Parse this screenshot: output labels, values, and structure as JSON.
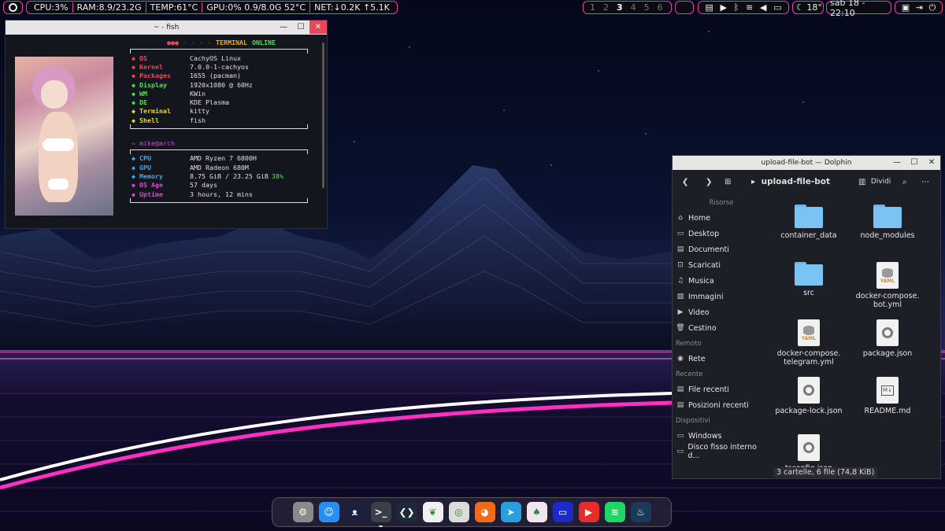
{
  "topbar": {
    "stats": [
      "CPU:3%",
      "RAM:8.9/23.2G",
      "TEMP:61°C",
      "GPU:0%  0.9/8.0G  52°C",
      "NET:↓0.2K ↑5.1K"
    ],
    "workspaces": [
      "1",
      "2",
      "3",
      "4",
      "5",
      "6"
    ],
    "active_workspace": "3",
    "tray_icons": [
      "clipboard-icon",
      "media-icon",
      "bluetooth-icon",
      "wifi-icon",
      "volume-icon",
      "battery-icon"
    ],
    "weather": "18°",
    "datetime": "sab 18 - 22:10"
  },
  "terminal": {
    "title": "~ - fish",
    "header_a": "TERMINAL",
    "header_b": "ONLINE",
    "sys": [
      {
        "key": "OS",
        "value": "CachyOS Linux",
        "color": "#e8485a"
      },
      {
        "key": "Kernel",
        "value": "7.0.0-1-cachyos",
        "color": "#e8485a"
      },
      {
        "key": "Packages",
        "value": "1655 (pacman)",
        "color": "#e8485a"
      },
      {
        "key": "Display",
        "value": "1920x1080 @ 60Hz",
        "color": "#4fe04f"
      },
      {
        "key": "WM",
        "value": "KWin",
        "color": "#4fe04f"
      },
      {
        "key": "DE",
        "value": "KDE Plasma",
        "color": "#4fe04f"
      },
      {
        "key": "Terminal",
        "value": "kitty",
        "color": "#f5d623"
      },
      {
        "key": "Shell",
        "value": "fish",
        "color": "#f5d623"
      }
    ],
    "user": "mike@arch",
    "hw": [
      {
        "key": "CPU",
        "value": "AMD Ryzen 7 6800H",
        "color": "#4aa3f0"
      },
      {
        "key": "GPU",
        "value": "AMD Radeon 680M",
        "color": "#4aa3f0"
      },
      {
        "key": "Memory",
        "value": "8.75 GiB / 23.25 GiB",
        "extra": "38%",
        "color": "#4aa3f0"
      },
      {
        "key": "OS Age",
        "value": "57 days",
        "color": "#d24ad8"
      },
      {
        "key": "Uptime",
        "value": "3 hours, 12 mins",
        "color": "#d24ad8"
      }
    ]
  },
  "dolphin": {
    "title": "upload-file-bot — Dolphin",
    "path": "upload-file-bot",
    "split_label": "Dividi",
    "sidebar": [
      {
        "type": "cat",
        "label": "Risorse"
      },
      {
        "type": "item",
        "label": "Home",
        "icon": "⌂"
      },
      {
        "type": "item",
        "label": "Desktop",
        "icon": "▭"
      },
      {
        "type": "item",
        "label": "Documenti",
        "icon": "▤"
      },
      {
        "type": "item",
        "label": "Scaricati",
        "icon": "⊡"
      },
      {
        "type": "item",
        "label": "Musica",
        "icon": "♫"
      },
      {
        "type": "item",
        "label": "Immagini",
        "icon": "▨"
      },
      {
        "type": "item",
        "label": "Video",
        "icon": "▶"
      },
      {
        "type": "item",
        "label": "Cestino",
        "icon": "🗑"
      },
      {
        "type": "cat",
        "label": "Remoto"
      },
      {
        "type": "item",
        "label": "Rete",
        "icon": "◉"
      },
      {
        "type": "cat",
        "label": "Recente"
      },
      {
        "type": "item",
        "label": "File recenti",
        "icon": "▤"
      },
      {
        "type": "item",
        "label": "Posizioni recenti",
        "icon": "▤"
      },
      {
        "type": "cat",
        "label": "Dispositivi"
      },
      {
        "type": "item",
        "label": "Windows",
        "icon": "▭"
      },
      {
        "type": "item",
        "label": "Disco fisso interno d...",
        "icon": "▭"
      }
    ],
    "files": [
      {
        "name": "container_data",
        "kind": "folder"
      },
      {
        "name": "node_modules",
        "kind": "folder"
      },
      {
        "name": "src",
        "kind": "folder"
      },
      {
        "name": "docker-compose.\nbot.yml",
        "kind": "yaml"
      },
      {
        "name": "docker-compose.\ntelegram.yml",
        "kind": "yaml"
      },
      {
        "name": "package.json",
        "kind": "json"
      },
      {
        "name": "package-lock.json",
        "kind": "json"
      },
      {
        "name": "README.md",
        "kind": "md"
      },
      {
        "name": "tsconfig.json",
        "kind": "json"
      }
    ],
    "status": "3 cartelle, 6 file (74,8 KiB)"
  },
  "dock": [
    {
      "name": "settings",
      "color": "#8a8a8a",
      "glyph": "⚙"
    },
    {
      "name": "finder",
      "color": "#2a8ef0",
      "glyph": "☺"
    },
    {
      "name": "cat-app",
      "color": "#1b2240",
      "glyph": "ᴥ"
    },
    {
      "name": "terminal",
      "color": "#3a3f4a",
      "glyph": ">_",
      "active": true
    },
    {
      "name": "vscode",
      "color": "#1e2a3a",
      "glyph": "❮❯"
    },
    {
      "name": "mongodb",
      "color": "#f1f1f1",
      "glyph": "❦"
    },
    {
      "name": "chrome",
      "color": "#dcdcdc",
      "glyph": "◎"
    },
    {
      "name": "firefox",
      "color": "#f06a1a",
      "glyph": "◕"
    },
    {
      "name": "telegram",
      "color": "#2a9fe0",
      "glyph": "➤"
    },
    {
      "name": "vesktop",
      "color": "#f1e6f0",
      "glyph": "♠"
    },
    {
      "name": "screen-app",
      "color": "#1b2bc8",
      "glyph": "▭"
    },
    {
      "name": "youtube",
      "color": "#e82b2b",
      "glyph": "▶"
    },
    {
      "name": "spotify",
      "color": "#1ed760",
      "glyph": "≋"
    },
    {
      "name": "steam",
      "color": "#1b3a5a",
      "glyph": "♨"
    }
  ]
}
